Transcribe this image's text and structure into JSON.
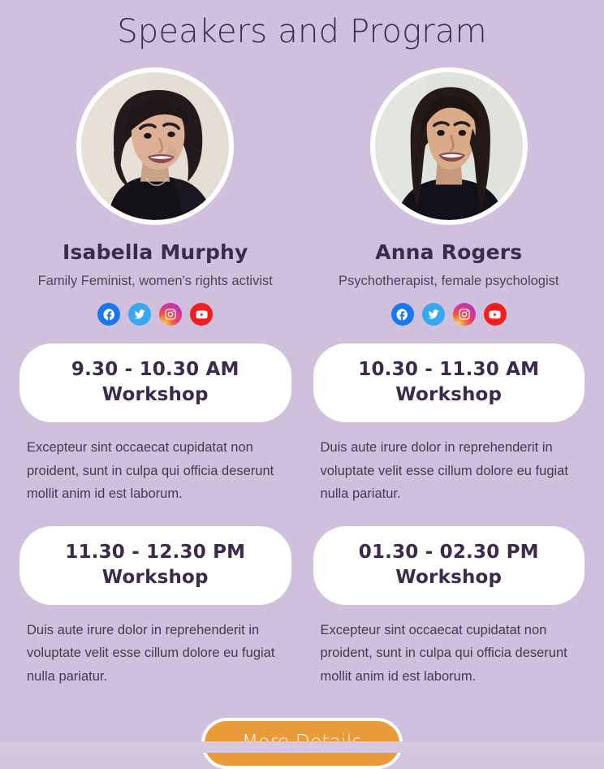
{
  "section": {
    "title": "Speakers and Program"
  },
  "colors": {
    "background": "#d0c0dd",
    "heading": "#3b2a4d",
    "body_text": "#413b4e",
    "card_background": "#ffffff",
    "cta_background": "#e99b39",
    "cta_text": "#ffffff",
    "facebook": "#1778f2",
    "twitter": "#38a8f0",
    "instagram": "#e63a73",
    "youtube": "#f51e1e"
  },
  "speakers": [
    {
      "name": "Isabella Murphy",
      "role": "Family Feminist, women's rights activist",
      "avatar_alt": "portrait-isabella-murphy",
      "socials": [
        {
          "network": "facebook",
          "icon": "facebook-icon"
        },
        {
          "network": "twitter",
          "icon": "twitter-icon"
        },
        {
          "network": "instagram",
          "icon": "instagram-icon"
        },
        {
          "network": "youtube",
          "icon": "youtube-icon"
        }
      ]
    },
    {
      "name": "Anna Rogers",
      "role": "Psychotherapist, female psychologist",
      "avatar_alt": "portrait-anna-rogers",
      "socials": [
        {
          "network": "facebook",
          "icon": "facebook-icon"
        },
        {
          "network": "twitter",
          "icon": "twitter-icon"
        },
        {
          "network": "instagram",
          "icon": "instagram-icon"
        },
        {
          "network": "youtube",
          "icon": "youtube-icon"
        }
      ]
    }
  ],
  "program": {
    "rows": [
      {
        "sessions": [
          {
            "time": "9.30 - 10.30 AM",
            "label": "Workshop",
            "description": "Excepteur sint occaecat cupidatat non proident, sunt in culpa qui officia deserunt mollit anim id est laborum."
          },
          {
            "time": "10.30 - 11.30 AM",
            "label": "Workshop",
            "description": "Duis aute irure dolor in reprehenderit in voluptate velit esse cillum dolore eu fugiat nulla pariatur."
          }
        ]
      },
      {
        "sessions": [
          {
            "time": "11.30 - 12.30 PM",
            "label": "Workshop",
            "description": "Duis aute irure dolor in reprehenderit in voluptate velit esse cillum dolore eu fugiat nulla pariatur."
          },
          {
            "time": "01.30 - 02.30 PM",
            "label": "Workshop",
            "description": "Excepteur sint occaecat cupidatat non proident, sunt in culpa qui officia deserunt mollit anim id est laborum."
          }
        ]
      }
    ]
  },
  "cta": {
    "label": "More Details"
  }
}
